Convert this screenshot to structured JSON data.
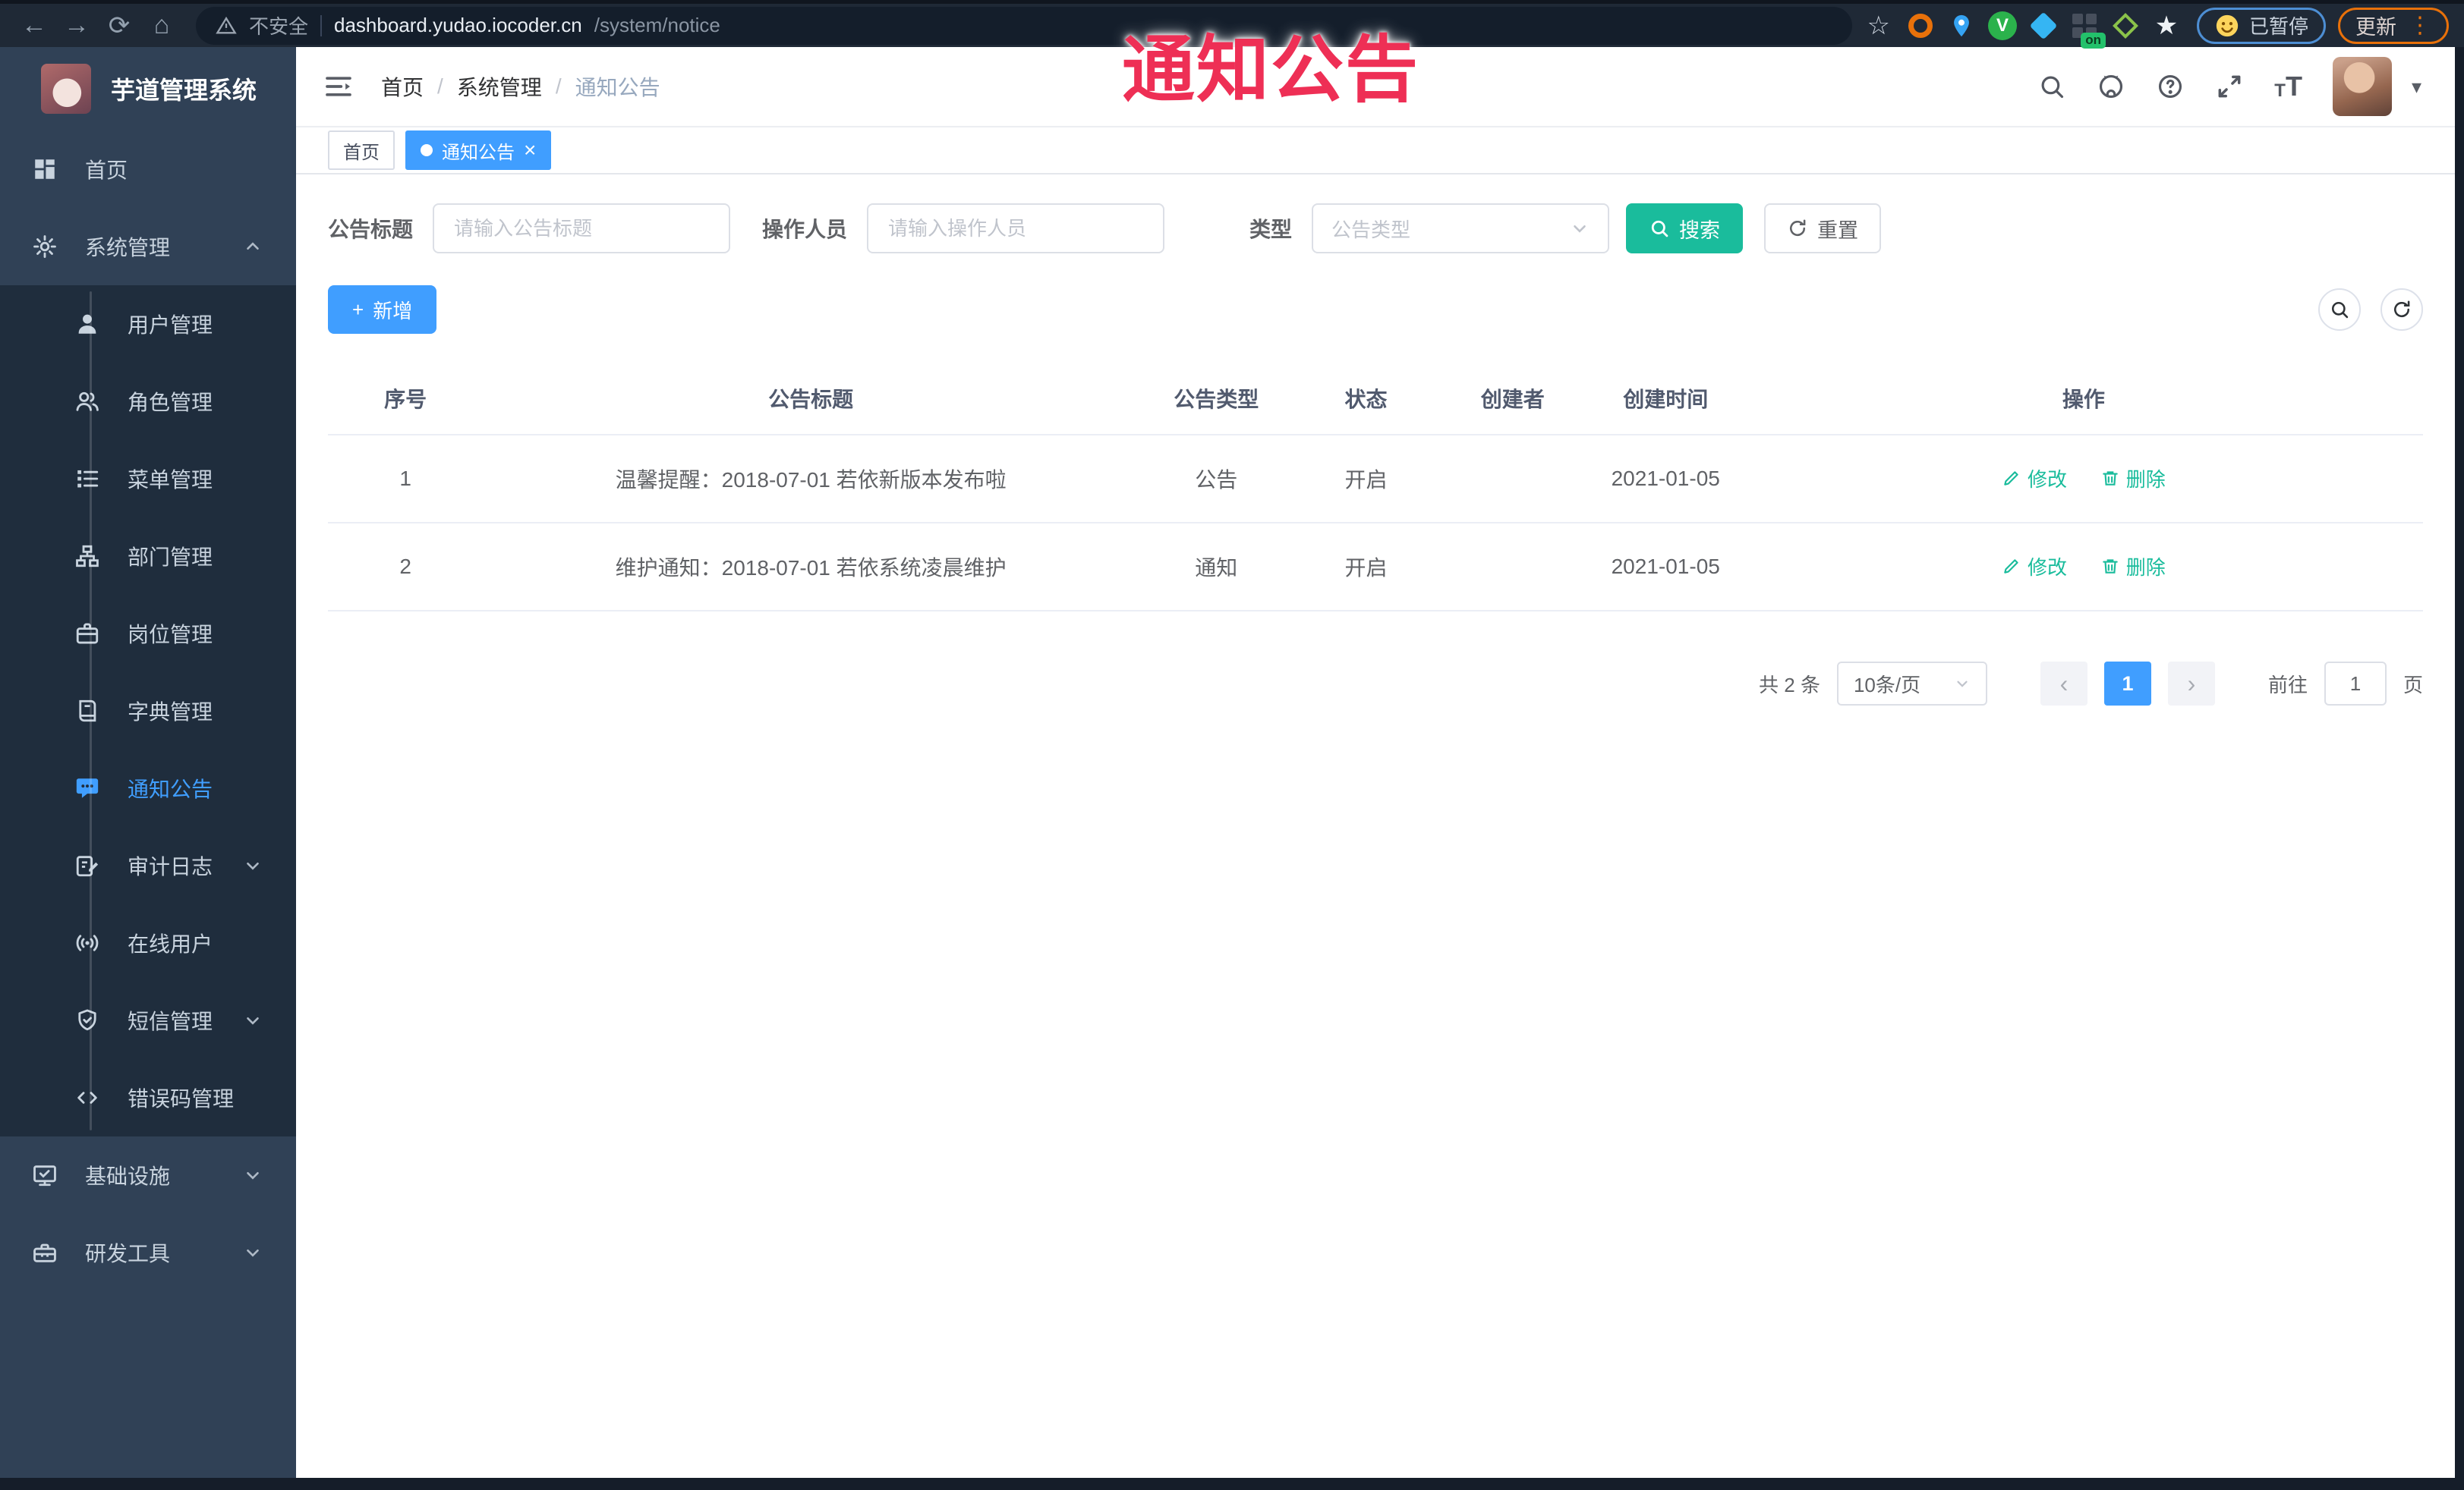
{
  "annotation": {
    "text": "通知公告"
  },
  "colors": {
    "accent": "#409eff",
    "teal": "#1abc9c",
    "annotation_red": "#ee2f55",
    "sidebar_bg": "#304156",
    "submenu_bg": "#1f2d3d"
  },
  "icons": {
    "back": "←",
    "forward": "→",
    "reload": "⟳",
    "home": "⌂",
    "bookmark_star": "☆",
    "flower": "★",
    "kebab": "⋮",
    "caret": "▾",
    "close": "×",
    "prev": "‹",
    "next": "›",
    "font_small": "T",
    "font_large": "T",
    "plus": "+"
  },
  "browser": {
    "security": "不安全",
    "url_host": "dashboard.yudao.iocoder.cn",
    "url_path": "/system/notice",
    "ext_v": "V",
    "ext_on": "on",
    "paused": "已暂停",
    "update": "更新"
  },
  "sidebar": {
    "title": "芋道管理系统",
    "home": "首页",
    "system": "系统管理",
    "children": [
      "用户管理",
      "角色管理",
      "菜单管理",
      "部门管理",
      "岗位管理",
      "字典管理",
      "通知公告",
      "审计日志",
      "在线用户",
      "短信管理",
      "错误码管理"
    ],
    "infra": "基础设施",
    "dev": "研发工具"
  },
  "header": {
    "breadcrumb": [
      "首页",
      "系统管理",
      "通知公告"
    ],
    "separator": "/"
  },
  "tags": {
    "items": [
      {
        "label": "首页",
        "active": false
      },
      {
        "label": "通知公告",
        "active": true
      }
    ]
  },
  "filters": {
    "title_label": "公告标题",
    "title_placeholder": "请输入公告标题",
    "operator_label": "操作人员",
    "operator_placeholder": "请输入操作人员",
    "type_label": "类型",
    "type_placeholder": "公告类型",
    "search_label": "搜索",
    "reset_label": "重置"
  },
  "toolbar": {
    "add_label": "新增"
  },
  "table": {
    "columns": [
      "序号",
      "公告标题",
      "公告类型",
      "状态",
      "创建者",
      "创建时间",
      "操作"
    ],
    "rows": [
      {
        "no": "1",
        "title": "温馨提醒：2018-07-01 若依新版本发布啦",
        "type": "公告",
        "status": "开启",
        "creator": "",
        "created": "2021-01-05"
      },
      {
        "no": "2",
        "title": "维护通知：2018-07-01 若依系统凌晨维护",
        "type": "通知",
        "status": "开启",
        "creator": "",
        "created": "2021-01-05"
      }
    ],
    "ops": {
      "edit": "修改",
      "delete": "删除"
    }
  },
  "pagination": {
    "total": "共 2 条",
    "size": "10条/页",
    "page": "1",
    "goto_label": "前往",
    "goto_value": "1",
    "unit": "页"
  }
}
